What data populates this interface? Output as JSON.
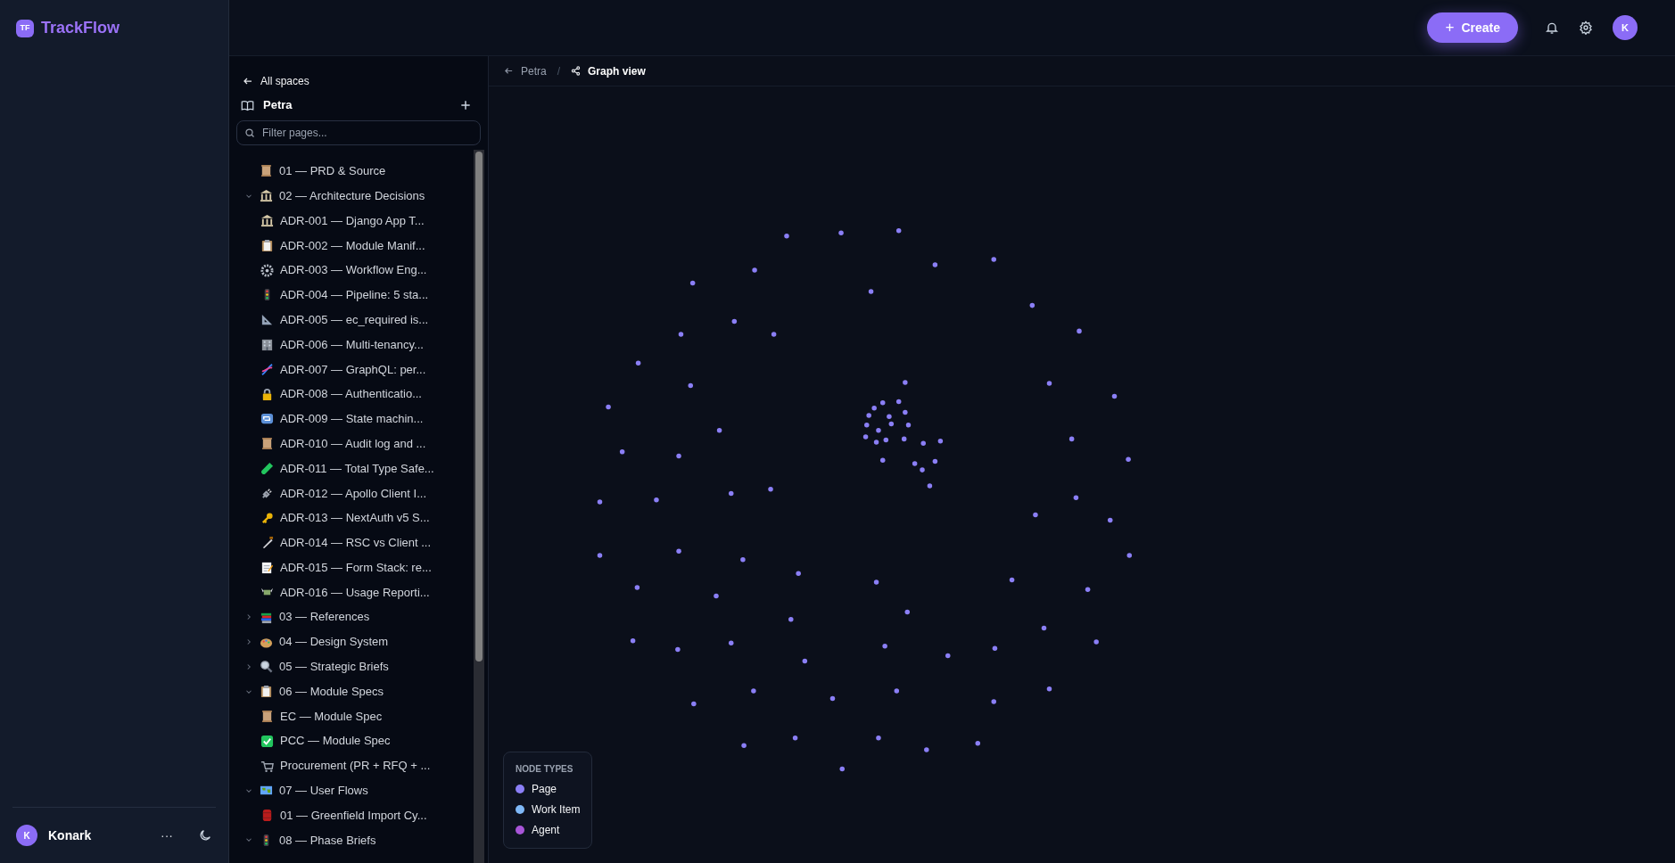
{
  "brand": {
    "logo": "TF",
    "name": "TrackFlow"
  },
  "header": {
    "create_button": {
      "icon": "+",
      "label": "Create"
    },
    "avatar": "K"
  },
  "user": {
    "avatar": "K",
    "name": "Konark",
    "more": "···"
  },
  "space_panel": {
    "back_link": "All spaces",
    "space_name": "Petra",
    "filter": {
      "placeholder": "Filter pages..."
    },
    "tree": [
      {
        "kind": "scroll",
        "label": "01 — PRD & Source"
      },
      {
        "kind": "columns",
        "label": "02 — Architecture Decisions",
        "expanded": true,
        "children": [
          {
            "kind": "columns",
            "label": "ADR-001 — Django App T..."
          },
          {
            "kind": "clipboard",
            "label": "ADR-002 — Module Manif..."
          },
          {
            "kind": "gear",
            "label": "ADR-003 — Workflow Eng..."
          },
          {
            "kind": "traffic",
            "label": "ADR-004 — Pipeline: 5 sta..."
          },
          {
            "kind": "ruler",
            "label": "ADR-005 — ec_required is..."
          },
          {
            "kind": "office",
            "label": "ADR-006 — Multi-tenancy..."
          },
          {
            "kind": "dna",
            "label": "ADR-007 — GraphQL: per..."
          },
          {
            "kind": "lock",
            "label": "ADR-008 — Authenticatio..."
          },
          {
            "kind": "repeat",
            "label": "ADR-009 — State machin..."
          },
          {
            "kind": "scroll",
            "label": "ADR-010 — Audit log and ..."
          },
          {
            "kind": "tube",
            "label": "ADR-011 — Total Type Safe..."
          },
          {
            "kind": "plug",
            "label": "ADR-012 — Apollo Client I..."
          },
          {
            "kind": "key",
            "label": "ADR-013 — NextAuth v5 S..."
          },
          {
            "kind": "saw",
            "label": "ADR-014 — RSC vs Client ..."
          },
          {
            "kind": "memo",
            "label": "ADR-015 — Form Stack: re..."
          },
          {
            "kind": "money",
            "label": "ADR-016 — Usage Reporti..."
          }
        ]
      },
      {
        "kind": "books",
        "label": "03 — References",
        "expanded": false
      },
      {
        "kind": "palette",
        "label": "04 — Design System",
        "expanded": false
      },
      {
        "kind": "magnifier",
        "label": "05 — Strategic Briefs",
        "expanded": false
      },
      {
        "kind": "clipboard",
        "label": "06 — Module Specs",
        "expanded": true,
        "children": [
          {
            "kind": "scroll",
            "label": "EC — Module Spec"
          },
          {
            "kind": "check",
            "label": "PCC — Module Spec"
          },
          {
            "kind": "cart",
            "label": "Procurement (PR + RFQ + ..."
          }
        ]
      },
      {
        "kind": "map",
        "label": "07 — User Flows",
        "expanded": true,
        "children": [
          {
            "kind": "barrel",
            "label": "01 — Greenfield Import Cy..."
          }
        ]
      },
      {
        "kind": "traffic",
        "label": "08 — Phase Briefs",
        "expanded": true
      }
    ]
  },
  "graph": {
    "breadcrumb": {
      "parent": "Petra",
      "separator": "/",
      "current": "Graph view"
    },
    "legend": {
      "title": "NODE TYPES",
      "items": [
        {
          "label": "Page",
          "color": "#8b7ff6"
        },
        {
          "label": "Work Item",
          "color": "#7fb8f7"
        },
        {
          "label": "Agent",
          "color": "#a855d8"
        }
      ]
    }
  }
}
